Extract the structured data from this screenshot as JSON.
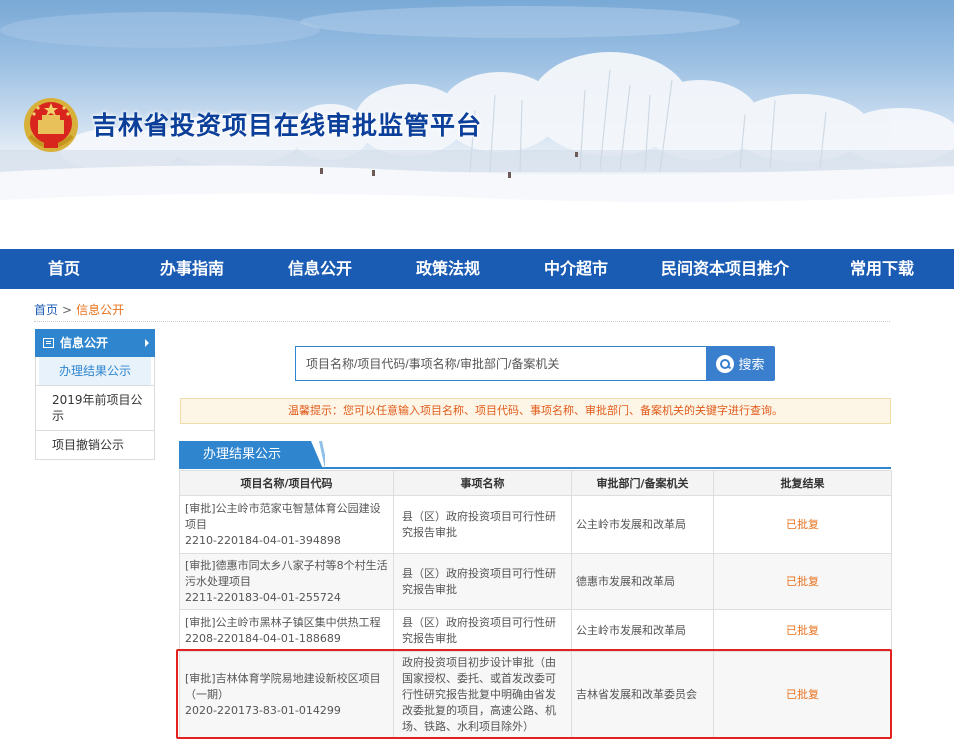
{
  "site": {
    "title": "吉林省投资项目在线审批监管平台"
  },
  "nav": {
    "items": [
      "首页",
      "办事指南",
      "信息公开",
      "政策法规",
      "中介超市",
      "民间资本项目推介",
      "常用下载"
    ]
  },
  "breadcrumb": {
    "home": "首页",
    "separator": ">",
    "current": "信息公开"
  },
  "sidebar": {
    "header": "信息公开",
    "items": [
      "办理结果公示",
      "2019年前项目公示",
      "项目撤销公示"
    ]
  },
  "search": {
    "placeholder": "项目名称/项目代码/事项名称/审批部门/备案机关",
    "button_label": "搜索"
  },
  "tip": {
    "text": "温馨提示：您可以任意输入项目名称、项目代码、事项名称、审批部门、备案机关的关键字进行查询。"
  },
  "section": {
    "tab_label": "办理结果公示"
  },
  "table": {
    "headers": [
      "项目名称/项目代码",
      "事项名称",
      "审批部门/备案机关",
      "批复结果"
    ],
    "rows": [
      {
        "name": "[审批]公主岭市范家屯智慧体育公园建设项目",
        "code": "2210-220184-04-01-394898",
        "item": "县（区）政府投资项目可行性研究报告审批",
        "dept": "公主岭市发展和改革局",
        "result": "已批复"
      },
      {
        "name": "[审批]德惠市同太乡八家子村等8个村生活污水处理项目",
        "code": "2211-220183-04-01-255724",
        "item": "县（区）政府投资项目可行性研究报告审批",
        "dept": "德惠市发展和改革局",
        "result": "已批复"
      },
      {
        "name": "[审批]公主岭市黑林子镇区集中供热工程",
        "code": "2208-220184-04-01-188689",
        "item": "县（区）政府投资项目可行性研究报告审批",
        "dept": "公主岭市发展和改革局",
        "result": "已批复"
      },
      {
        "name": "[审批]吉林体育学院易地建设新校区项目（一期）",
        "code": "2020-220173-83-01-014299",
        "item": "政府投资项目初步设计审批（由国家授权、委托、或首发改委可行性研究报告批复中明确由省发改委批复的项目，高速公路、机场、铁路、水利项目除外）",
        "dept": "吉林省发展和改革委员会",
        "result": "已批复"
      }
    ]
  },
  "colors": {
    "nav_bg": "#1a5bb4",
    "accent": "#2f86cf",
    "result": "#e8711d",
    "highlight": "#e3211e"
  }
}
